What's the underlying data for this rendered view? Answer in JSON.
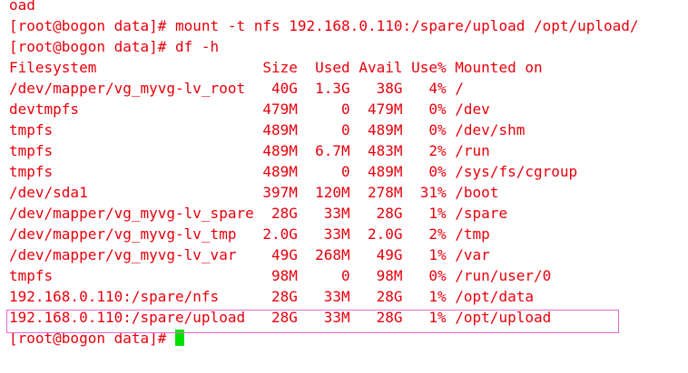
{
  "terminal": {
    "text_color": "#e8000b",
    "background": "#ffffff",
    "cursor_color": "#00e000",
    "highlight_color": "#e06bd6",
    "lines": [
      "oad",
      "[root@bogon data]# mount -t nfs 192.168.0.110:/spare/upload /opt/upload/",
      "[root@bogon data]# df -h",
      "Filesystem                   Size  Used Avail Use% Mounted on",
      "/dev/mapper/vg_myvg-lv_root   40G  1.3G   38G   4% /",
      "devtmpfs                     479M     0  479M   0% /dev",
      "tmpfs                        489M     0  489M   0% /dev/shm",
      "tmpfs                        489M  6.7M  483M   2% /run",
      "tmpfs                        489M     0  489M   0% /sys/fs/cgroup",
      "/dev/sda1                    397M  120M  278M  31% /boot",
      "/dev/mapper/vg_myvg-lv_spare  28G   33M   28G   1% /spare",
      "/dev/mapper/vg_myvg-lv_tmp   2.0G   33M  2.0G   2% /tmp",
      "/dev/mapper/vg_myvg-lv_var    49G  268M   49G   1% /var",
      "tmpfs                         98M     0   98M   0% /run/user/0",
      "192.168.0.110:/spare/nfs      28G   33M   28G   1% /opt/data",
      "192.168.0.110:/spare/upload   28G   33M   28G   1% /opt/upload"
    ],
    "prompt": "[root@bogon data]# "
  }
}
